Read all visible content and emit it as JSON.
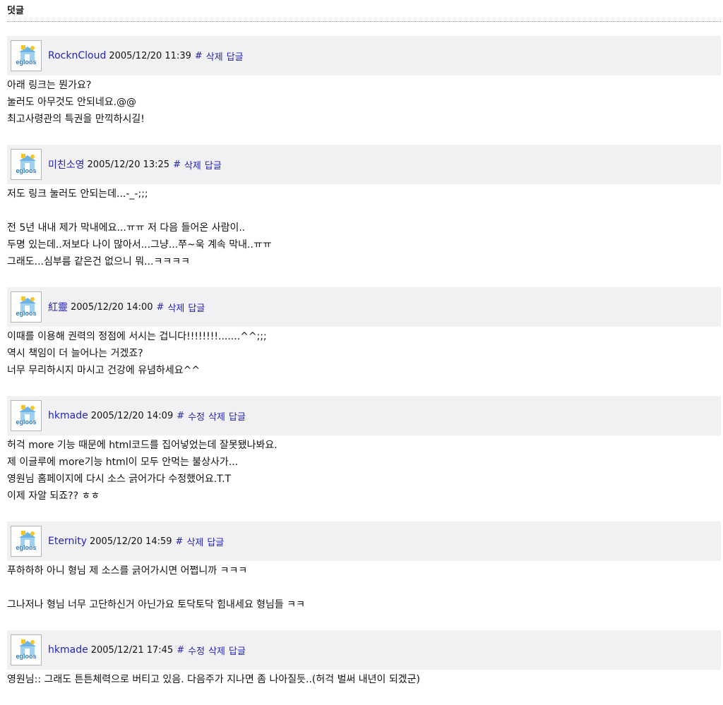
{
  "section_title": "덧글",
  "brand_text": "egloos",
  "comments": [
    {
      "author": "RocknCloud",
      "date": "2005/12/20 11:39",
      "links": [
        "#",
        "삭제",
        "답글"
      ],
      "lines": [
        "아래 링크는 뭔가요?",
        "눌러도 아무것도 안되네요.@@",
        "최고사령관의 특권을 만끽하시길!"
      ]
    },
    {
      "author": "미친소영",
      "date": "2005/12/20 13:25",
      "links": [
        "#",
        "삭제",
        "답글"
      ],
      "lines": [
        "저도 링크 눌러도 안되는데...-_-;;;",
        "",
        "전 5년 내내 제가 막내에요...ㅠㅠ 저 다음 들어온 사람이..",
        "두명 있는데..저보다 나이 많아서...그냥...쭈~욱 계속 막내..ㅠㅠ",
        "그래도...심부름 같은건 없으니 뭐...ㅋㅋㅋㅋ"
      ]
    },
    {
      "author": "紅靈",
      "date": "2005/12/20 14:00",
      "links": [
        "#",
        "삭제",
        "답글"
      ],
      "lines": [
        "이때를 이용해 권력의 정점에 서시는 겁니다!!!!!!!!.......^^;;;",
        "역시 책임이 더 늘어나는 거겠죠?",
        "너무 무리하시지 마시고 건강에 유념하세요^^"
      ]
    },
    {
      "author": "hkmade",
      "date": "2005/12/20 14:09",
      "links": [
        "#",
        "수정",
        "삭제",
        "답글"
      ],
      "lines": [
        "허걱 more 기능 때문에 html코드를 집어넣었는데 잘못됐나봐요.",
        "제 이글루에 more기능 html이 모두 안먹는 불상사가...",
        "영원님 홈페이지에 다시 소스 긁어가다 수정했어요.T.T",
        "이제 자알 되죠?? ㅎㅎ"
      ]
    },
    {
      "author": "Eternity",
      "date": "2005/12/20 14:59",
      "links": [
        "#",
        "삭제",
        "답글"
      ],
      "lines": [
        "푸하하하 아니 형님 제 소스를 긁어가시면 어쩝니까 ㅋㅋㅋ",
        "",
        "그나저나 형님 너무 고단하신거 아닌가요 토닥토닥 힘내세요 형님들 ㅋㅋ"
      ]
    },
    {
      "author": "hkmade",
      "date": "2005/12/21 17:45",
      "links": [
        "#",
        "수정",
        "삭제",
        "답글"
      ],
      "lines": [
        "영원님:: 그래도 튼튼체력으로 버티고 있음. 다음주가 지나면 좀 나아질듯..(허걱 벌써 내년이 되겠군)"
      ]
    }
  ]
}
